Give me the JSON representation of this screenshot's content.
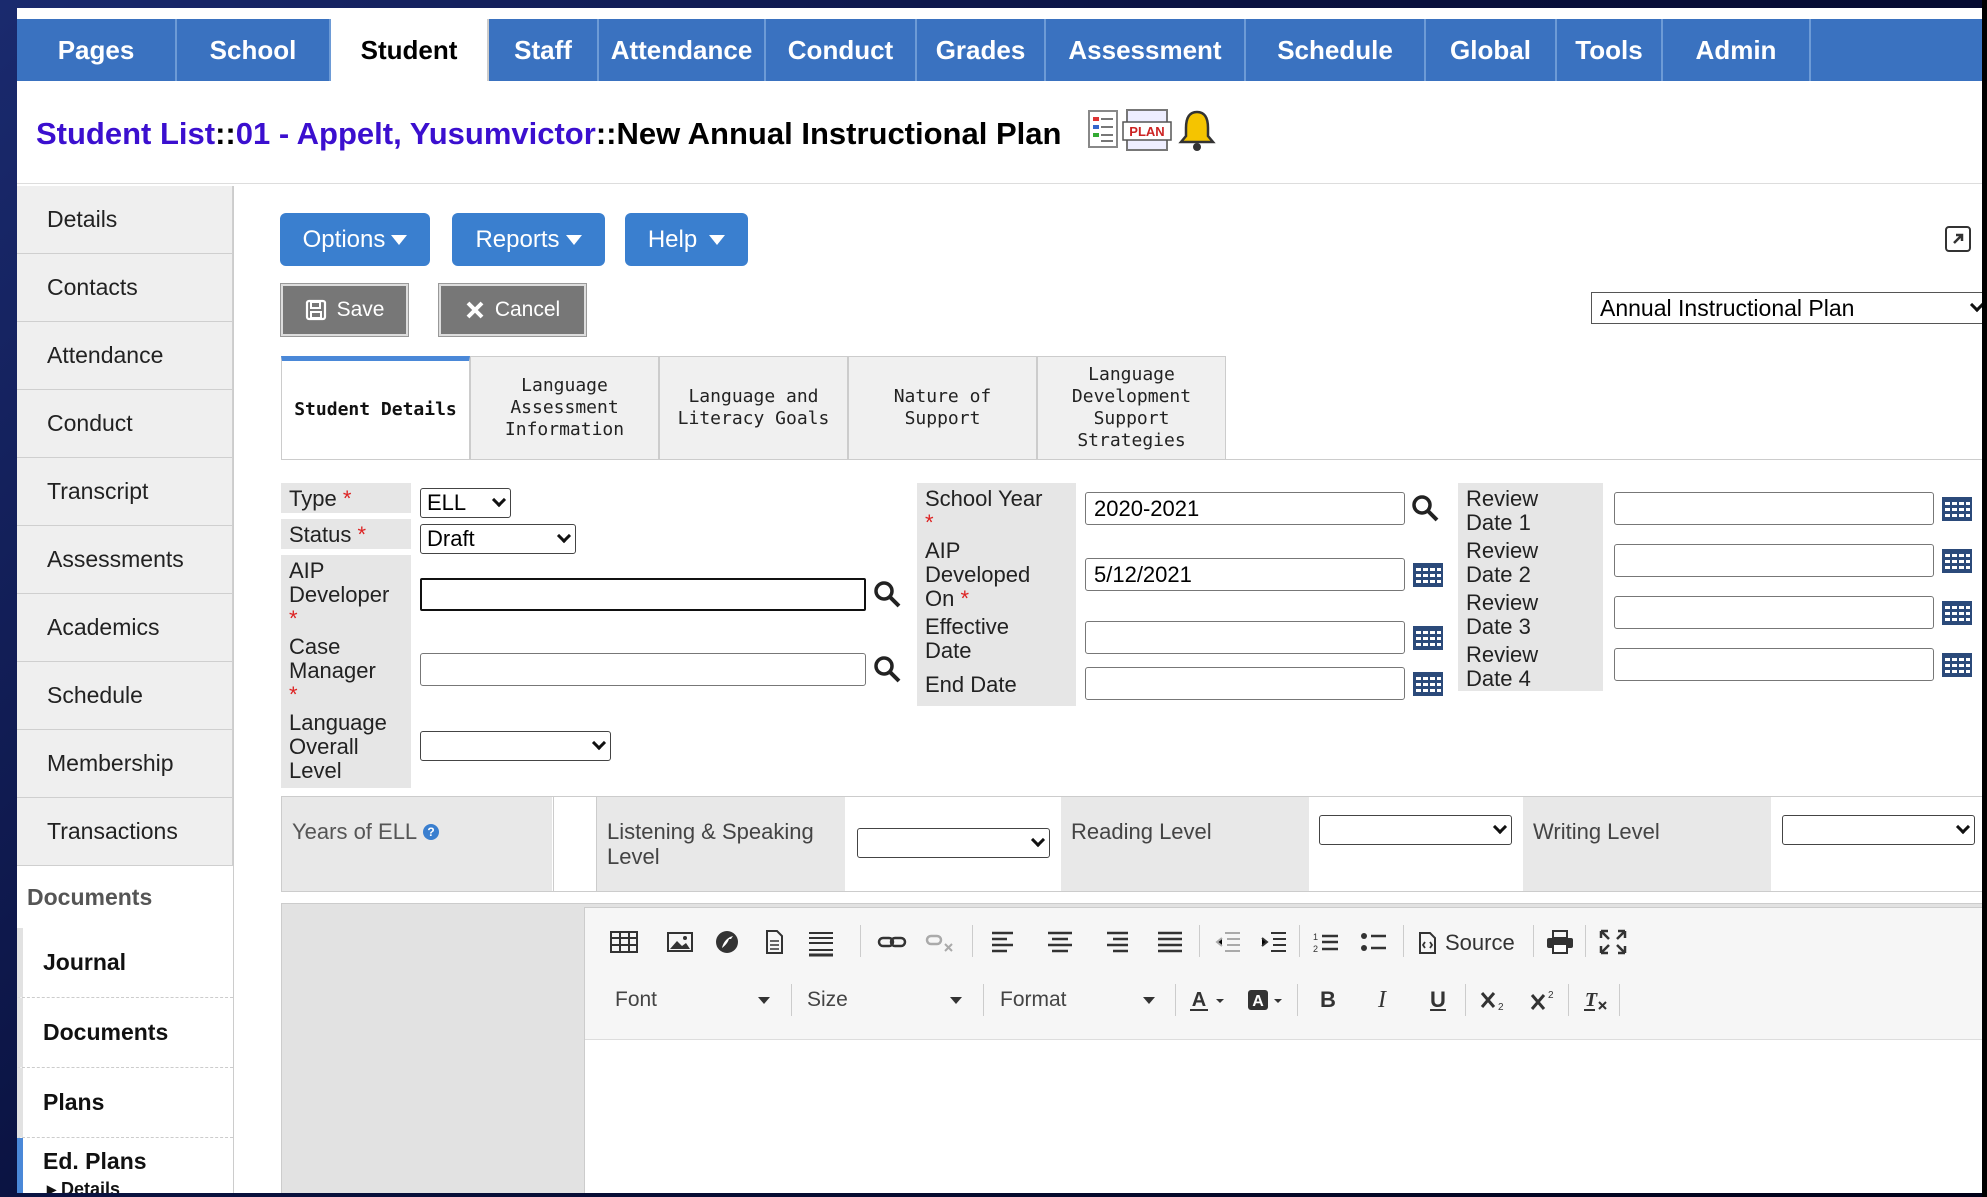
{
  "topnav": {
    "tabs": [
      {
        "label": "Pages",
        "w": 160
      },
      {
        "label": "School",
        "w": 154
      },
      {
        "label": "Student",
        "w": 158
      },
      {
        "label": "Staff",
        "w": 110
      },
      {
        "label": "Attendance",
        "w": 167
      },
      {
        "label": "Conduct",
        "w": 151
      },
      {
        "label": "Grades",
        "w": 129
      },
      {
        "label": "Assessment",
        "w": 200
      },
      {
        "label": "Schedule",
        "w": 180
      },
      {
        "label": "Global",
        "w": 131
      },
      {
        "label": "Tools",
        "w": 106
      },
      {
        "label": "Admin",
        "w": 148
      }
    ],
    "active": "Student"
  },
  "breadcrumb": {
    "list_link": "Student List",
    "sep1": " :: ",
    "student_link": "01 - Appelt, Yusumvictor",
    "sep2": " :: ",
    "current": "New Annual Instructional Plan",
    "plan_icon_text": "PLAN"
  },
  "sidebar": {
    "items": [
      "Details",
      "Contacts",
      "Attendance",
      "Conduct",
      "Transcript",
      "Assessments",
      "Academics",
      "Schedule",
      "Membership",
      "Transactions"
    ],
    "documents_header": "Documents",
    "doc_items": [
      "Journal",
      "Documents",
      "Plans",
      "Ed. Plans"
    ],
    "active_doc": "Ed. Plans",
    "sub_item": "▸ Details"
  },
  "toolbar": {
    "options_label": "Options",
    "reports_label": "Reports",
    "help_label": "Help",
    "save_label": "Save",
    "cancel_label": "Cancel",
    "plan_type_selected": "Annual Instructional Plan"
  },
  "tabs": [
    {
      "label": "Student Details",
      "active": true
    },
    {
      "label": "Language Assessment Information",
      "active": false
    },
    {
      "label": "Language and Literacy Goals",
      "active": false
    },
    {
      "label": "Nature of Support",
      "active": false
    },
    {
      "label": "Language Development Support Strategies",
      "active": false
    }
  ],
  "form": {
    "type_label": "Type",
    "type_value": "ELL",
    "status_label": "Status",
    "status_value": "Draft",
    "aip_developer_label": "AIP Developer",
    "aip_developer_value": "",
    "case_manager_label": "Case Manager",
    "case_manager_value": "",
    "language_level_label": "Language Overall Level",
    "language_level_value": "",
    "school_year_label": "School Year",
    "school_year_value": "2020-2021",
    "aip_developed_on_label": "AIP Developed On",
    "aip_developed_on_value": "5/12/2021",
    "effective_date_label": "Effective Date",
    "effective_date_value": "",
    "end_date_label": "End Date",
    "end_date_value": "",
    "review_date_1_label": "Review Date 1",
    "review_date_2_label": "Review Date 2",
    "review_date_3_label": "Review Date 3",
    "review_date_4_label": "Review Date 4",
    "required_mark": "*"
  },
  "levels": {
    "years_of_ell_label": "Years of ELL",
    "listening_label": "Listening & Speaking Level",
    "reading_label": "Reading Level",
    "writing_label": "Writing Level"
  },
  "editor": {
    "source_label": "Source",
    "font_label": "Font",
    "size_label": "Size",
    "format_label": "Format"
  },
  "colors": {
    "nav_blue": "#3a72c0",
    "link_purple": "#3b0fcf",
    "button_blue": "#3a7fcf",
    "required_red": "#dd2222"
  }
}
